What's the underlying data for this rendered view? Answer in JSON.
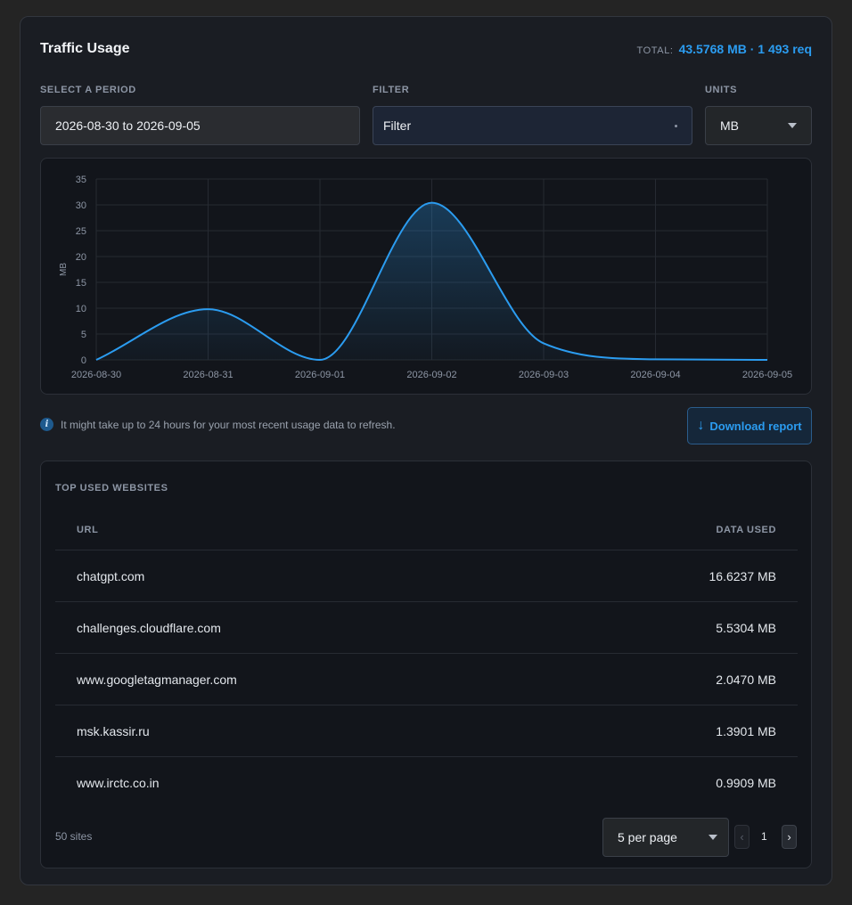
{
  "header": {
    "title": "Traffic Usage",
    "total_label": "TOTAL:",
    "total_value": "43.5768 MB · 1 493 req"
  },
  "controls": {
    "period_label": "SELECT A PERIOD",
    "period_value": "2026-08-30 to 2026-09-05",
    "filter_label": "FILTER",
    "filter_value": "Filter",
    "units_label": "UNITS",
    "units_value": "MB"
  },
  "chart_data": {
    "type": "area",
    "ylabel": "MB",
    "ylim": [
      0,
      35
    ],
    "yticks": [
      0,
      5,
      10,
      15,
      20,
      25,
      30,
      35
    ],
    "categories": [
      "2026-08-30",
      "2026-08-31",
      "2026-09-01",
      "2026-09-02",
      "2026-09-03",
      "2026-09-04",
      "2026-09-05"
    ],
    "values": [
      0,
      9.8,
      0,
      30.4,
      3.2,
      0.1,
      0
    ],
    "grid": true,
    "color": "#2b9cf0"
  },
  "notice": {
    "text": "It might take up to 24 hours for your most recent usage data to refresh.",
    "icon": "info-icon"
  },
  "download": {
    "label": "Download report",
    "arrow": "↓"
  },
  "table": {
    "title": "TOP USED WEBSITES",
    "col_url": "URL",
    "col_data": "DATA USED",
    "rows": [
      {
        "url": "chatgpt.com",
        "data": "16.6237 MB"
      },
      {
        "url": "challenges.cloudflare.com",
        "data": "5.5304 MB"
      },
      {
        "url": "www.googletagmanager.com",
        "data": "2.0470 MB"
      },
      {
        "url": "msk.kassir.ru",
        "data": "1.3901 MB"
      },
      {
        "url": "www.irctc.co.in",
        "data": "0.9909 MB"
      }
    ],
    "sites_count": "50 sites",
    "per_page": "5 per page",
    "page": "1"
  },
  "colors": {
    "accent": "#2b9cf0",
    "background": "#1a1d23"
  }
}
